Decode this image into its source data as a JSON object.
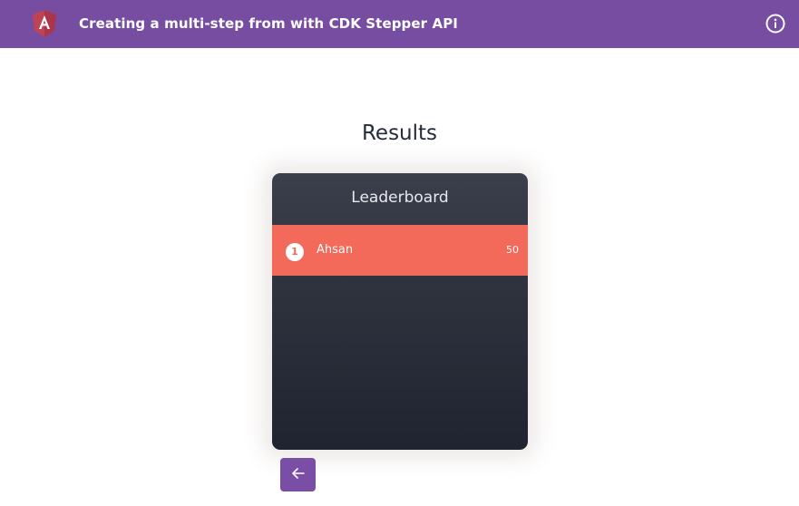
{
  "header": {
    "title": "Creating a multi-step from with CDK Stepper API",
    "logo_icon": "angular-logo-icon",
    "info_icon": "info-circle-icon",
    "background_color": "#774da2"
  },
  "main": {
    "heading": "Results"
  },
  "leaderboard": {
    "title": "Leaderboard",
    "highlight_color": "#f36a5a",
    "entries": [
      {
        "rank": "1",
        "name": "Ahsan",
        "score": "50"
      }
    ]
  },
  "navigation": {
    "back_icon": "arrow-left-icon",
    "button_color": "#7b4ea6"
  }
}
